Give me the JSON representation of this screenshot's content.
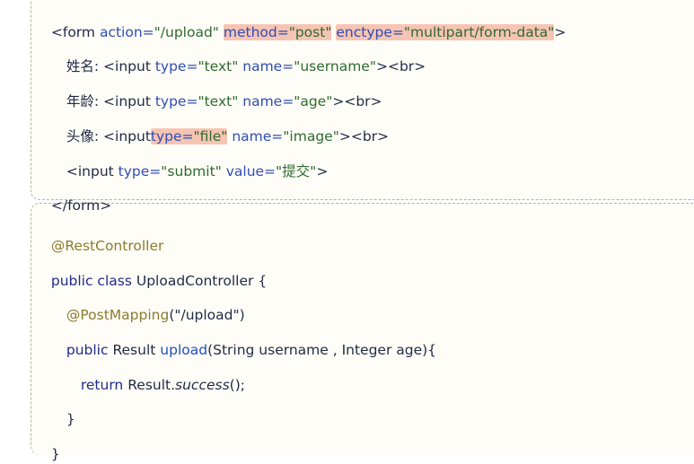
{
  "html_code": {
    "form_open": {
      "lt": "<",
      "tag": "form",
      "a1": "action=",
      "v1": "\"/upload\"",
      "a2": "method=",
      "v2": "\"post\"",
      "a3": "enctype=",
      "v3": "\"multipart/form-data\"",
      "gt": ">"
    },
    "username_line": {
      "label": "姓名:",
      "lt": "<",
      "tag": "input",
      "a1": "type=",
      "v1": "\"text\"",
      "a2": "name=",
      "v2": "\"username\"",
      "tail": "><br>"
    },
    "age_line": {
      "label": "年龄:",
      "lt": "<",
      "tag": "input",
      "a1": "type=",
      "v1": "\"text\"",
      "a2": "name=",
      "v2": "\"age\"",
      "tail": "><br>"
    },
    "image_line": {
      "label": "头像:",
      "lt": "<",
      "tag": "input",
      "a1": "type=",
      "v1": "\"file\"",
      "a2": "name=",
      "v2": "\"image\"",
      "tail": "><br>"
    },
    "submit_line": {
      "lt": "<",
      "tag": "input",
      "a1": "type=",
      "v1": "\"submit\"",
      "a2": "value=",
      "v2": "\"提交\"",
      "gt": ">"
    },
    "form_close": "</form>"
  },
  "java_code": {
    "annotation1": "@RestController",
    "class_kw": "public class",
    "class_name": "UploadController {",
    "annotation2": "@PostMapping",
    "annotation2_arg": "(\"/upload\")",
    "method_kw": "public",
    "method_type": "Result",
    "method_name": "upload",
    "method_params": "(String username , Integer age){",
    "return_kw": "return",
    "return_obj": "Result.",
    "return_call": "success",
    "return_tail": "();",
    "close_inner": "}",
    "close_outer": "}"
  },
  "colors": {
    "highlight": "#f6c4b3",
    "block_bg": "#fffdf7",
    "annotation": "#8a7b2e",
    "attribute": "#2f4db3",
    "string": "#2e6a2f"
  }
}
